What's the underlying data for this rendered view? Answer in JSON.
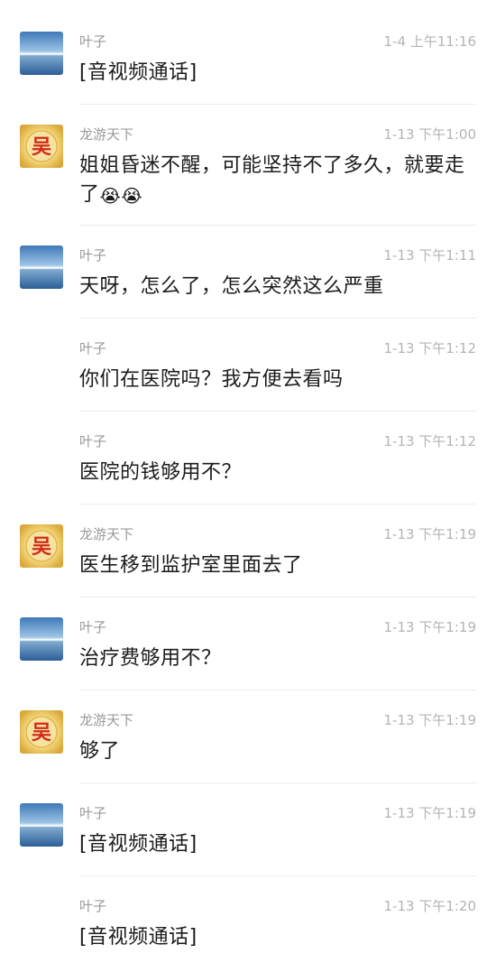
{
  "messages": [
    {
      "sender": "叶子",
      "time": "1-4 上午11:16",
      "text": "[音视频通话]"
    },
    {
      "sender": "龙游天下",
      "time": "1-13 下午1:00",
      "text": "姐姐昏迷不醒，可能坚持不了多久，就要走了",
      "emojis": "😭😭"
    },
    {
      "sender": "叶子",
      "time": "1-13 下午1:11",
      "text": "天呀，怎么了，怎么突然这么严重"
    },
    {
      "sender": "叶子",
      "time": "1-13 下午1:12",
      "text": "你们在医院吗？我方便去看吗"
    },
    {
      "sender": "叶子",
      "time": "1-13 下午1:12",
      "text": "医院的钱够用不？"
    },
    {
      "sender": "龙游天下",
      "time": "1-13 下午1:19",
      "text": "医生移到监护室里面去了"
    },
    {
      "sender": "叶子",
      "time": "1-13 下午1:19",
      "text": "治疗费够用不？"
    },
    {
      "sender": "龙游天下",
      "time": "1-13 下午1:19",
      "text": "够了"
    },
    {
      "sender": "叶子",
      "time": "1-13 下午1:19",
      "text": "[音视频通话]"
    },
    {
      "sender": "叶子",
      "time": "1-13 下午1:20",
      "text": "[音视频通话]"
    }
  ],
  "avatars": {
    "longyou_char": "吴"
  }
}
